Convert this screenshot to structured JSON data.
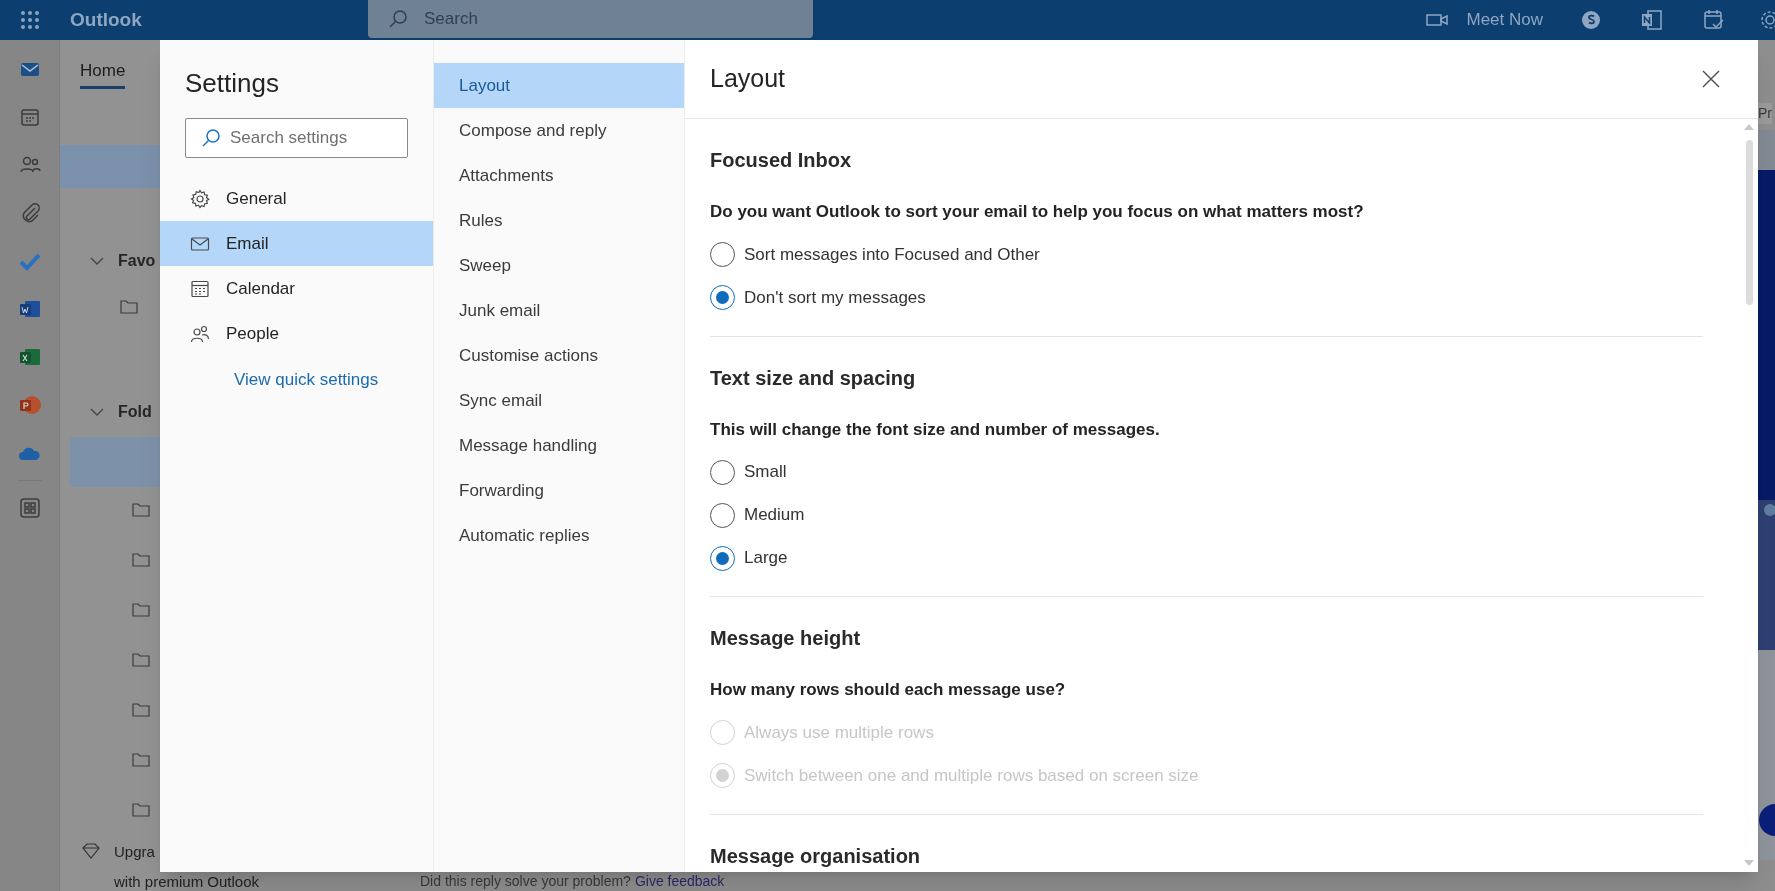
{
  "top_bar": {
    "app_name": "Outlook",
    "search": {
      "placeholder": "Search"
    },
    "meet_now": "Meet Now"
  },
  "background": {
    "tab": "Home",
    "folder_fragments": [
      "Favo",
      "Fold"
    ],
    "upgrade": [
      "Upgra",
      "with premium Outlook"
    ],
    "feedback": {
      "text": "Did this reply solve your problem?",
      "link": "Give feedback"
    },
    "reading_pane_fragment": "Pr"
  },
  "settings": {
    "title": "Settings",
    "search": {
      "placeholder": "Search settings"
    },
    "categories": [
      {
        "label": "General",
        "selected": false
      },
      {
        "label": "Email",
        "selected": true
      },
      {
        "label": "Calendar",
        "selected": false
      },
      {
        "label": "People",
        "selected": false
      }
    ],
    "quick_settings_link": "View quick settings",
    "subcategories": [
      {
        "label": "Layout",
        "selected": true
      },
      {
        "label": "Compose and reply",
        "selected": false
      },
      {
        "label": "Attachments",
        "selected": false
      },
      {
        "label": "Rules",
        "selected": false
      },
      {
        "label": "Sweep",
        "selected": false
      },
      {
        "label": "Junk email",
        "selected": false
      },
      {
        "label": "Customise actions",
        "selected": false
      },
      {
        "label": "Sync email",
        "selected": false
      },
      {
        "label": "Message handling",
        "selected": false
      },
      {
        "label": "Forwarding",
        "selected": false
      },
      {
        "label": "Automatic replies",
        "selected": false
      }
    ],
    "page_title": "Layout",
    "sections": [
      {
        "heading": "Focused Inbox",
        "question": "Do you want Outlook to sort your email to help you focus on what matters most?",
        "options": [
          {
            "label": "Sort messages into Focused and Other",
            "selected": false,
            "disabled": false
          },
          {
            "label": "Don't sort my messages",
            "selected": true,
            "disabled": false
          }
        ]
      },
      {
        "heading": "Text size and spacing",
        "question": "This will change the font size and number of messages.",
        "options": [
          {
            "label": "Small",
            "selected": false,
            "disabled": false
          },
          {
            "label": "Medium",
            "selected": false,
            "disabled": false
          },
          {
            "label": "Large",
            "selected": true,
            "disabled": false
          }
        ]
      },
      {
        "heading": "Message height",
        "question": "How many rows should each message use?",
        "options": [
          {
            "label": "Always use multiple rows",
            "selected": false,
            "disabled": true
          },
          {
            "label": "Switch between one and multiple rows based on screen size",
            "selected": true,
            "disabled": true
          }
        ]
      },
      {
        "heading": "Message organisation"
      }
    ]
  }
}
